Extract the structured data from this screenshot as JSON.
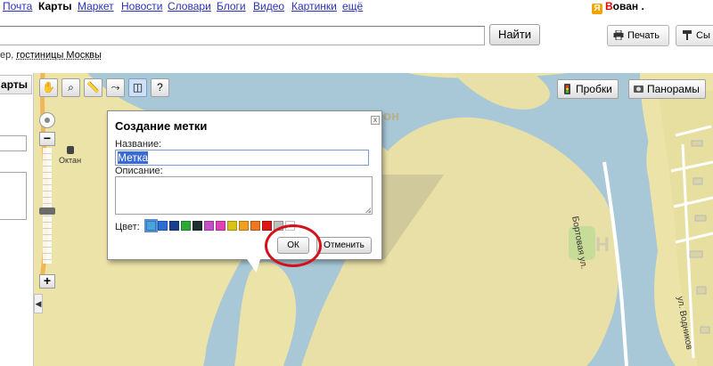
{
  "nav": {
    "items": [
      {
        "label": "Почта",
        "current": false
      },
      {
        "label": "Карты",
        "current": true
      },
      {
        "label": "Маркет",
        "current": false
      },
      {
        "label": "Новости",
        "current": false
      },
      {
        "label": "Словари",
        "current": false
      },
      {
        "label": "Блоги",
        "current": false
      },
      {
        "label": "Видео",
        "current": false
      },
      {
        "label": "Картинки",
        "current": false
      },
      {
        "label": "ещё",
        "current": false
      }
    ],
    "user_badge": "Я",
    "user_first": "В",
    "user_rest": "ован ."
  },
  "search": {
    "button_label": "Найти",
    "print_label": "Печать",
    "second_tool_label": "Сы",
    "example_prefix": "ер, ",
    "example_link": "гостиницы Москвы"
  },
  "left_panel": {
    "tab_label": "арты",
    "collapse_glyph": "◀"
  },
  "map": {
    "toolbar_icons": [
      "hand-icon",
      "zoom-area-icon",
      "ruler-icon",
      "route-icon",
      "placemark-icon",
      "info-icon"
    ],
    "layers": {
      "traffic_label": "Пробки",
      "panoramas_label": "Панорамы"
    },
    "poi_label": "Октан",
    "river_text": "он",
    "street_1": "Бортовая ул.",
    "street_2": "ул. Водников",
    "zoom_in": "+",
    "zoom_out": "−"
  },
  "dialog": {
    "title": "Создание метки",
    "name_label": "Название:",
    "name_value": "Метка",
    "description_label": "Описание:",
    "description_value": "",
    "color_label": "Цвет:",
    "colors": [
      "#4aa3df",
      "#2a6fd6",
      "#1a3d8f",
      "#2fa83a",
      "#1f2f2f",
      "#c44fc9",
      "#e040b8",
      "#d9c21b",
      "#f0a020",
      "#ee7722",
      "#e01515",
      "#c0c0c0",
      "#ffffff"
    ],
    "selected_color_index": 0,
    "ok_label": "ОК",
    "cancel_label": "Отменить",
    "close_glyph": "x"
  },
  "annotation": {
    "circle_color": "#d4101a"
  }
}
